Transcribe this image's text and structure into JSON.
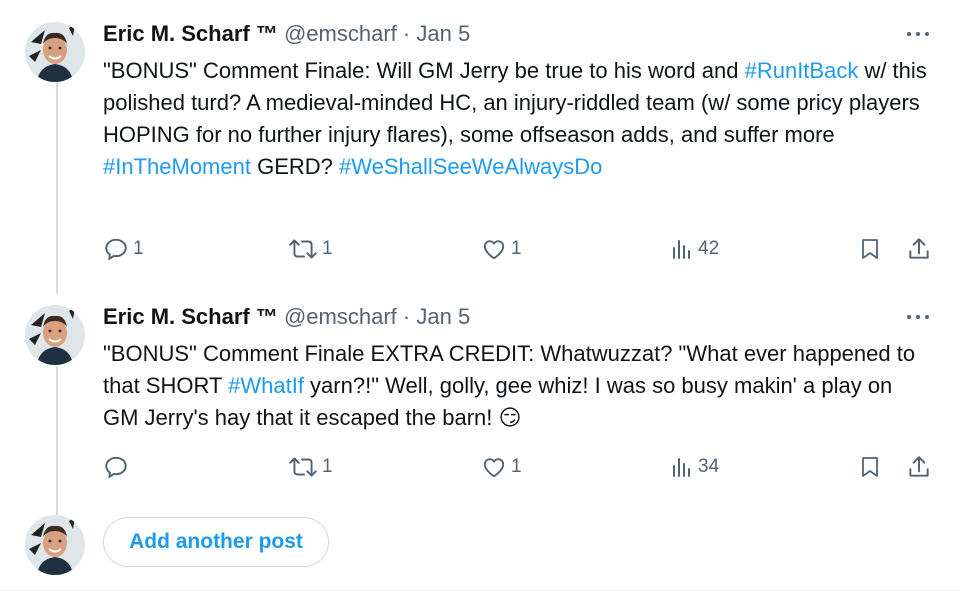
{
  "posts": [
    {
      "author_name": "Eric M. Scharf ™",
      "handle": "@emscharf",
      "separator": "·",
      "date": "Jan 5",
      "text_parts": [
        {
          "text": "\"BONUS\" Comment Finale: Will GM Jerry be true to his word and "
        },
        {
          "text": "#RunItBack",
          "hashtag": true
        },
        {
          "text": " w/ this polished turd? A medieval-minded HC, an injury-riddled team (w/ some pricy players HOPING for no further injury flares), some offseason adds, and suffer more "
        },
        {
          "text": "#InTheMoment",
          "hashtag": true
        },
        {
          "text": " GERD? "
        },
        {
          "text": "#WeShallSeeWeAlwaysDo",
          "hashtag": true
        }
      ],
      "replies": "1",
      "reposts": "1",
      "likes": "1",
      "views": "42"
    },
    {
      "author_name": "Eric M. Scharf ™",
      "handle": "@emscharf",
      "separator": "·",
      "date": "Jan 5",
      "text_parts": [
        {
          "text": "\"BONUS\" Comment Finale EXTRA CREDIT: Whatwuzzat? \"What ever happened to that SHORT "
        },
        {
          "text": "#WhatIf",
          "hashtag": true
        },
        {
          "text": " yarn?!\" Well, golly, gee whiz! I was so busy makin' a play on GM Jerry's hay that it escaped the barn! "
        },
        {
          "text": "😏",
          "emoji": true
        }
      ],
      "replies": "",
      "reposts": "1",
      "likes": "1",
      "views": "34"
    }
  ],
  "add_post_label": "Add another post",
  "icons": {
    "reply": "reply-icon",
    "repost": "repost-icon",
    "like": "heart-icon",
    "views": "views-icon",
    "bookmark": "bookmark-icon",
    "share": "share-icon",
    "more": "more-icon"
  },
  "colors": {
    "accent": "#1d9bf0",
    "text": "#0f1419",
    "secondary": "#536471",
    "border": "#cfd9de"
  }
}
